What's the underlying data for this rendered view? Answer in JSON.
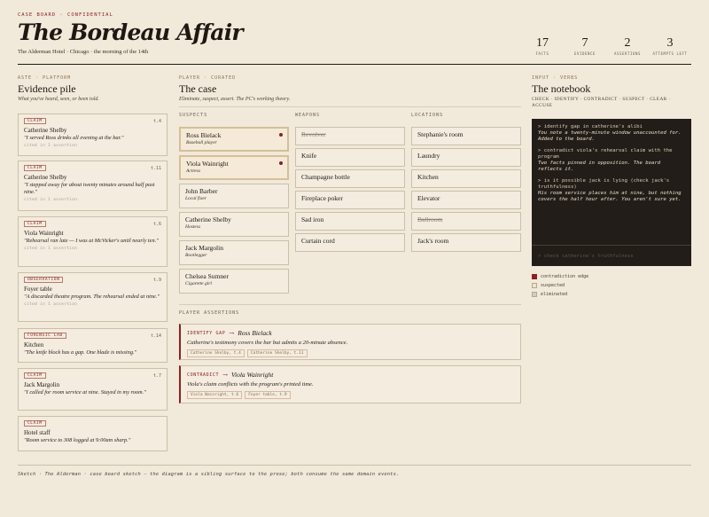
{
  "header": {
    "kicker": "CASE BOARD · CONFIDENTIAL",
    "title": "The Bordeau Affair",
    "subtitle": "The Alderman Hotel · Chicago · the morning of the 14th",
    "stats": [
      {
        "value": "17",
        "label": "FACTS"
      },
      {
        "value": "7",
        "label": "EVIDENCE"
      },
      {
        "value": "2",
        "label": "ASSERTIONS"
      },
      {
        "value": "3",
        "label": "ATTEMPTS LEFT"
      }
    ]
  },
  "evidence": {
    "kicker": "ASTE · PLATFORM",
    "title": "Evidence pile",
    "desc": "What you've heard, seen, or been told.",
    "cards": [
      {
        "tag": "CLAIM",
        "ref": "t.4",
        "name": "Catherine Shelby",
        "quote": "\"I served Ross drinks all evening at the bar.\"",
        "cite": "cited in 1 assertion"
      },
      {
        "tag": "CLAIM",
        "ref": "t.11",
        "name": "Catherine Shelby",
        "quote": "\"I stepped away for about twenty minutes around half past nine.\"",
        "cite": "cited in 1 assertion"
      },
      {
        "tag": "CLAIM",
        "ref": "t.6",
        "name": "Viola Wainright",
        "quote": "\"Rehearsal ran late — I was at McVicker's until nearly ten.\"",
        "cite": "cited in 1 assertion"
      },
      {
        "tag": "OBSERVATION",
        "ref": "t.9",
        "name": "Foyer table",
        "quote": "\"A discarded theatre program. The rehearsal ended at nine.\"",
        "cite": "cited in 1 assertion"
      },
      {
        "tag": "FORENSIC LAB",
        "ref": "t.14",
        "name": "Kitchen",
        "quote": "\"The knife block has a gap. One blade is missing.\"",
        "cite": ""
      },
      {
        "tag": "CLAIM",
        "ref": "t.7",
        "name": "Jack Margolin",
        "quote": "\"I called for room service at nine. Stayed in my room.\"",
        "cite": ""
      },
      {
        "tag": "CLAIM",
        "ref": "",
        "name": "Hotel staff",
        "quote": "\"Room service to 308 logged at 9:00am sharp.\"",
        "cite": ""
      }
    ]
  },
  "case": {
    "kicker": "PLAYER · CURATED",
    "title": "The case",
    "desc": "Eliminate, suspect, assert. The PC's working theory.",
    "suspects_label": "SUSPECTS",
    "weapons_label": "WEAPONS",
    "locations_label": "LOCATIONS",
    "suspects": [
      {
        "name": "Ross Bielack",
        "role": "Baseball player",
        "state": "suspected"
      },
      {
        "name": "Viola Wainright",
        "role": "Actress",
        "state": "suspected"
      },
      {
        "name": "John Barber",
        "role": "Local fixer",
        "state": "none"
      },
      {
        "name": "Catherine Shelby",
        "role": "Hostess",
        "state": "none"
      },
      {
        "name": "Jack Margolin",
        "role": "Bootlegger",
        "state": "none"
      },
      {
        "name": "Chelsea Sumner",
        "role": "Cigarette girl",
        "state": "none"
      }
    ],
    "weapons": [
      {
        "name": "Revolver",
        "state": "eliminated"
      },
      {
        "name": "Knife",
        "state": "none"
      },
      {
        "name": "Champagne bottle",
        "state": "none"
      },
      {
        "name": "Fireplace poker",
        "state": "none"
      },
      {
        "name": "Sad iron",
        "state": "none"
      },
      {
        "name": "Curtain cord",
        "state": "none"
      }
    ],
    "locations": [
      {
        "name": "Stephanie's room",
        "state": "none"
      },
      {
        "name": "Laundry",
        "state": "none"
      },
      {
        "name": "Kitchen",
        "state": "none"
      },
      {
        "name": "Elevator",
        "state": "none"
      },
      {
        "name": "Ballroom",
        "state": "eliminated"
      },
      {
        "name": "Jack's room",
        "state": "none"
      }
    ],
    "assertions_label": "PLAYER ASSERTIONS",
    "assertions": [
      {
        "tag": "IDENTIFY GAP",
        "arrow": "→",
        "target": "Ross Bielack",
        "desc": "Catherine's testimony covers the bar but admits a 20-minute absence.",
        "chips": [
          "Catherine Shelby, t.4",
          "Catherine Shelby, t.11"
        ]
      },
      {
        "tag": "CONTRADICT",
        "arrow": "→",
        "target": "Viola Wainright",
        "desc": "Viola's claim conflicts with the program's printed time.",
        "chips": [
          "Viola Wainright, t.6",
          "Foyer table, t.9"
        ]
      }
    ]
  },
  "notebook": {
    "kicker": "INPUT · VERBS",
    "title": "The notebook",
    "verbs": "CHECK · IDENTIFY · CONTRADICT · SUSPECT · CLEAR · ACCUSE",
    "entries": [
      {
        "cmd": "> identify gap in catherine's alibi",
        "out": "You note a twenty-minute window unaccounted for. Added to the board."
      },
      {
        "cmd": "> contradict viola's rehearsal claim with the program",
        "out": "Two facts pinned in opposition. The board reflects it."
      },
      {
        "cmd": "> is it possible jack is lying (check jack's truthfulness)",
        "out": "His room service places him at nine, but nothing covers the half hour after. You aren't sure yet."
      }
    ],
    "input_placeholder": "> check catherine's truthfulness",
    "legend": [
      {
        "label": "contradiction edge",
        "color": "#8a2222"
      },
      {
        "label": "suspected",
        "color": "#efe3cc"
      },
      {
        "label": "eliminated",
        "color": "#d6ccbd"
      }
    ]
  },
  "footer": "Sketch · The Alderman · case board sketch — the diagram is a sibling surface to the prose; both consume the same domain events."
}
